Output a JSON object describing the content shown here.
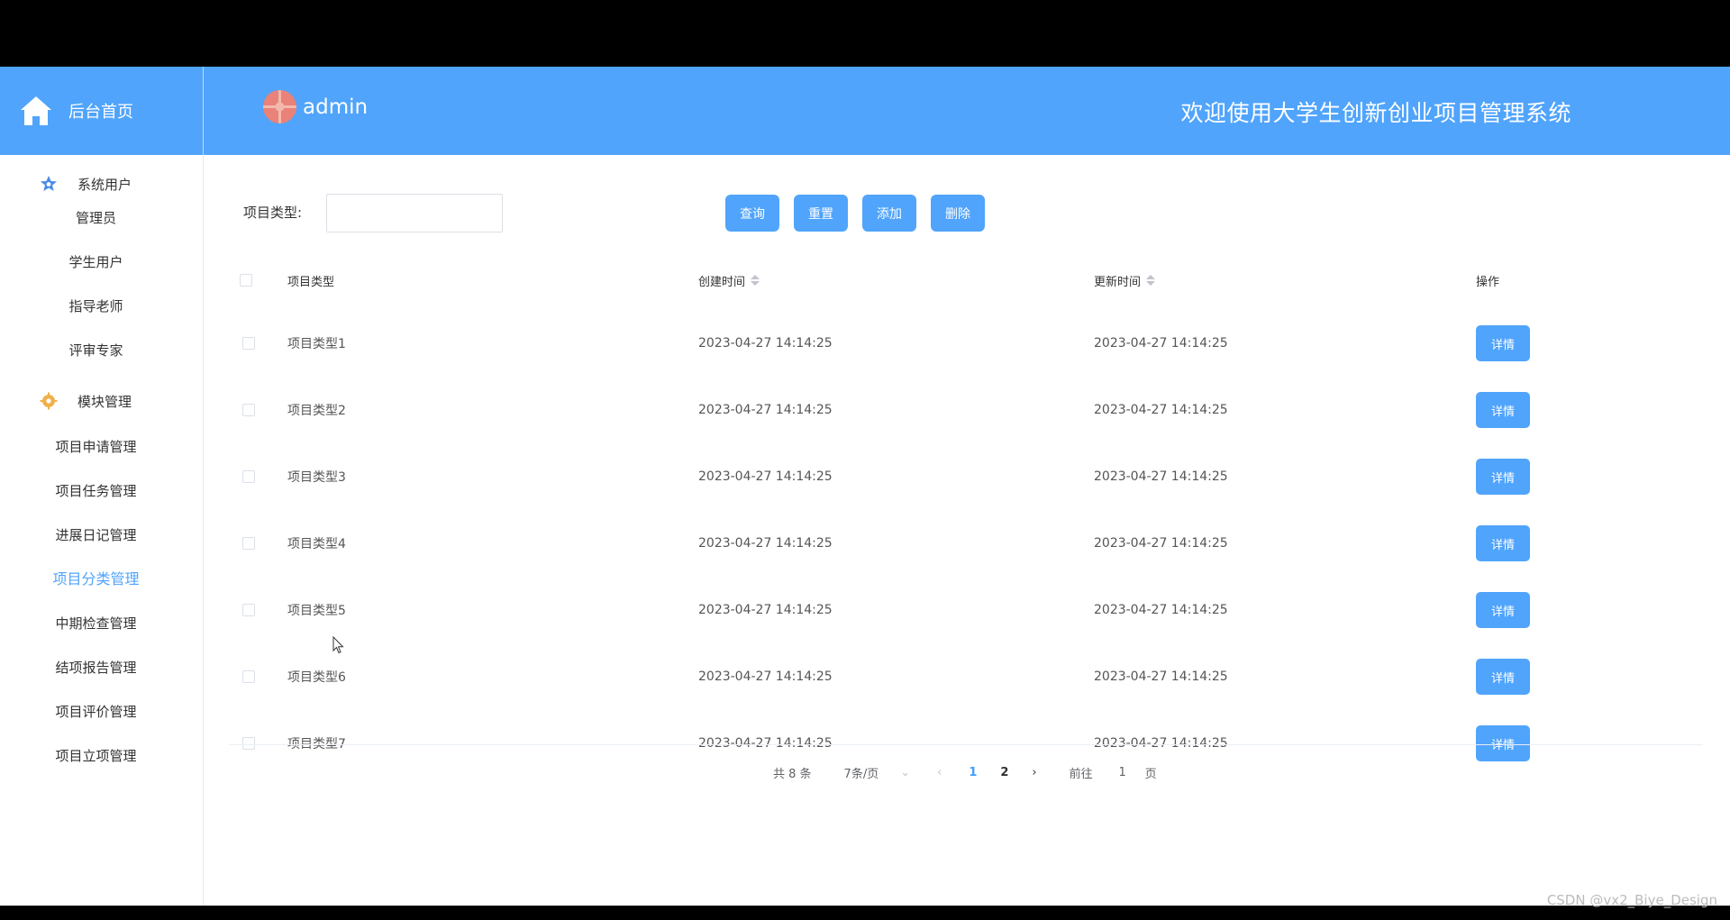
{
  "header": {
    "home_label": "后台首页",
    "username": "admin",
    "welcome": "欢迎使用大学生创新创业项目管理系统"
  },
  "sidebar": {
    "groups": [
      {
        "label": "系统用户",
        "icon": "star-badge-icon",
        "color": "#4a8ae8"
      },
      {
        "label": "模块管理",
        "icon": "gear-badge-icon",
        "color": "#f0b04a"
      }
    ],
    "items": [
      {
        "label": "管理员"
      },
      {
        "label": "学生用户"
      },
      {
        "label": "指导老师"
      },
      {
        "label": "评审专家"
      },
      {
        "label": "项目申请管理"
      },
      {
        "label": "项目任务管理"
      },
      {
        "label": "进展日记管理"
      },
      {
        "label": "项目分类管理",
        "active": true
      },
      {
        "label": "中期检查管理"
      },
      {
        "label": "结项报告管理"
      },
      {
        "label": "项目评价管理"
      },
      {
        "label": "项目立项管理"
      }
    ]
  },
  "search": {
    "label": "项目类型:",
    "value": ""
  },
  "toolbar": {
    "query": "查询",
    "reset": "重置",
    "add": "添加",
    "delete": "删除"
  },
  "table": {
    "columns": {
      "type": "项目类型",
      "create_time": "创建时间",
      "update_time": "更新时间",
      "op": "操作"
    },
    "detail_label": "详情",
    "rows": [
      {
        "type": "项目类型1",
        "create_time": "2023-04-27 14:14:25",
        "update_time": "2023-04-27 14:14:25"
      },
      {
        "type": "项目类型2",
        "create_time": "2023-04-27 14:14:25",
        "update_time": "2023-04-27 14:14:25"
      },
      {
        "type": "项目类型3",
        "create_time": "2023-04-27 14:14:25",
        "update_time": "2023-04-27 14:14:25"
      },
      {
        "type": "项目类型4",
        "create_time": "2023-04-27 14:14:25",
        "update_time": "2023-04-27 14:14:25"
      },
      {
        "type": "项目类型5",
        "create_time": "2023-04-27 14:14:25",
        "update_time": "2023-04-27 14:14:25"
      },
      {
        "type": "项目类型6",
        "create_time": "2023-04-27 14:14:25",
        "update_time": "2023-04-27 14:14:25"
      },
      {
        "type": "项目类型7",
        "create_time": "2023-04-27 14:14:25",
        "update_time": "2023-04-27 14:14:25"
      }
    ]
  },
  "pagination": {
    "total": "共 8 条",
    "page_size": "7条/页",
    "pages": [
      "1",
      "2"
    ],
    "current": "1",
    "goto_label": "前往",
    "goto_value": "1",
    "page_suffix": "页"
  },
  "watermark": "CSDN @vx2_Biye_Design",
  "colors": {
    "primary": "#50a4fc",
    "active_page": "#409eff"
  }
}
